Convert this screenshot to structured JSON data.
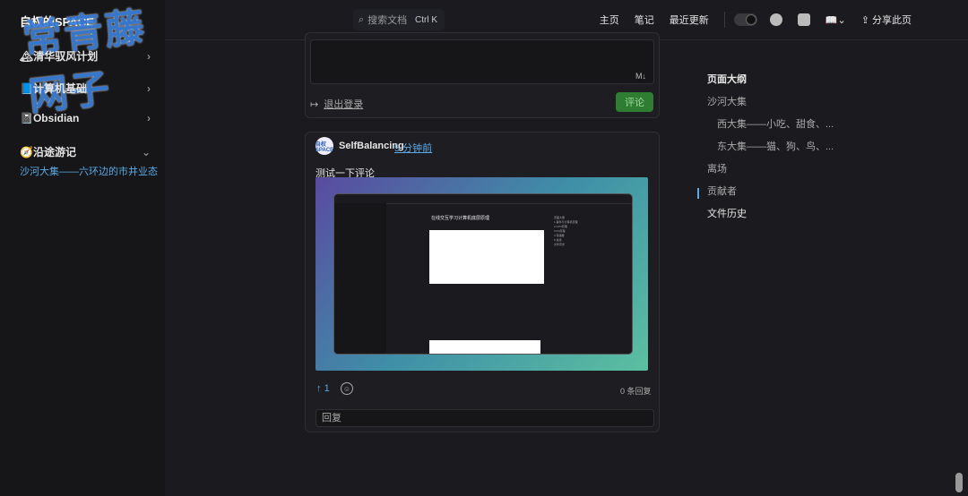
{
  "sidebar": {
    "brand": "自权的SPACE",
    "watermark": "常青藤网子",
    "groups": [
      {
        "icon": "🏔",
        "label": "清华驭风计划",
        "chev": "›"
      },
      {
        "icon": "📘",
        "label": "计算机基础",
        "chev": "›"
      },
      {
        "icon": "📓",
        "label": "Obsidian",
        "chev": "›"
      },
      {
        "icon": "🧭",
        "label": "沿途游记",
        "chev": "⌄"
      }
    ],
    "active_link": "沙河大集——六环边的市井业态"
  },
  "topbar": {
    "search_placeholder": "搜索文档",
    "search_shortcut": "Ctrl K",
    "nav": [
      "主页",
      "笔记",
      "最近更新"
    ],
    "share": "分享此页"
  },
  "comment_box": {
    "logout": "退出登录",
    "submit": "评论",
    "md_icon": "M↓"
  },
  "comment": {
    "avatar_text": "自权SPACE",
    "author": "SelfBalancing",
    "time": "5 分钟前",
    "text": "测试一下评论",
    "reaction_count": "1",
    "replies": "0 条回复",
    "reply_placeholder": "回复",
    "inner_shot": {
      "title": "在线交互学习计算机底层原理",
      "toc_lines": [
        "页面大纲",
        "1 事件与计算机原理",
        "2 CPU原理",
        "3 I/O原理",
        "4 存储器",
        "5 总线",
        "文件历史"
      ]
    }
  },
  "outline": {
    "heading": "页面大纲",
    "items": [
      {
        "label": "沙河大集",
        "sub": false
      },
      {
        "label": "西大集——小吃、甜食、...",
        "sub": true
      },
      {
        "label": "东大集——猫、狗、鸟、...",
        "sub": true
      },
      {
        "label": "离场",
        "sub": false
      },
      {
        "label": "贡献者",
        "sub": false
      },
      {
        "label": "文件历史",
        "sub": false,
        "active": true
      }
    ]
  }
}
